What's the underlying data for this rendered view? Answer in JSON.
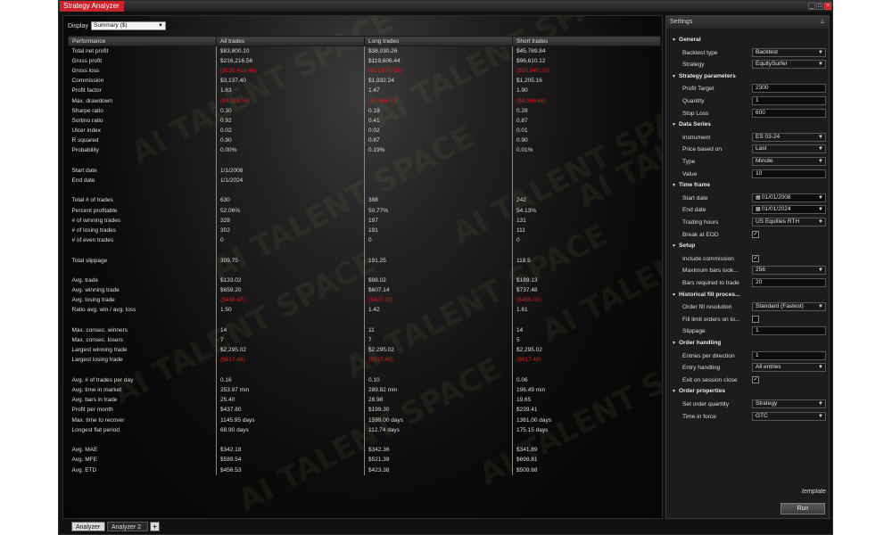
{
  "window": {
    "title": "Strategy Analyzer",
    "controls": [
      "_",
      "□",
      "×"
    ]
  },
  "display": {
    "label": "Display",
    "selected": "Summary ($)"
  },
  "table": {
    "columns": [
      "Performance",
      "All trades",
      "Long trades",
      "Short trades"
    ],
    "rows": [
      {
        "label": "Total net profit",
        "all": "$83,800.10",
        "long": "$38,030.26",
        "short": "$45,769.84"
      },
      {
        "label": "Gross profit",
        "all": "$216,216.56",
        "long": "$119,606.44",
        "short": "$96,610.12"
      },
      {
        "label": "Gross loss",
        "all": "($132,416.46)",
        "long": "($81,576.18)",
        "short": "($50,840.28)",
        "neg": true
      },
      {
        "label": "Commission",
        "all": "$3,137.40",
        "long": "$1,932.24",
        "short": "$1,205.16"
      },
      {
        "label": "Profit factor",
        "all": "1.63",
        "long": "1.47",
        "short": "1.90"
      },
      {
        "label": "Max. drawdown",
        "all": "($4,516.58)",
        "long": "($5,886.52)",
        "short": "($4,596.68)",
        "neg": true
      },
      {
        "label": "Sharpe ratio",
        "all": "0.30",
        "long": "0.19",
        "short": "0.28"
      },
      {
        "label": "Sortino ratio",
        "all": "0.92",
        "long": "0.41",
        "short": "0.87"
      },
      {
        "label": "Ulcer index",
        "all": "0.02",
        "long": "0.02",
        "short": "0.01"
      },
      {
        "label": "R squared",
        "all": "0.90",
        "long": "0.87",
        "short": "0.90"
      },
      {
        "label": "Probability",
        "all": "0.00%",
        "long": "0.19%",
        "short": "0.01%"
      },
      {
        "label": "",
        "all": "",
        "long": "",
        "short": ""
      },
      {
        "label": "Start date",
        "all": "1/1/2008",
        "long": "",
        "short": ""
      },
      {
        "label": "End date",
        "all": "1/1/2024",
        "long": "",
        "short": ""
      },
      {
        "label": "",
        "all": "",
        "long": "",
        "short": ""
      },
      {
        "label": "Total # of trades",
        "all": "630",
        "long": "388",
        "short": "242"
      },
      {
        "label": "Percent profitable",
        "all": "52.06%",
        "long": "50.77%",
        "short": "54.13%"
      },
      {
        "label": "# of winning trades",
        "all": "328",
        "long": "197",
        "short": "131"
      },
      {
        "label": "# of losing trades",
        "all": "302",
        "long": "191",
        "short": "111"
      },
      {
        "label": "# of even trades",
        "all": "0",
        "long": "0",
        "short": "0"
      },
      {
        "label": "",
        "all": "",
        "long": "",
        "short": ""
      },
      {
        "label": "Total slippage",
        "all": "309.75",
        "long": "191.25",
        "short": "118.5"
      },
      {
        "label": "",
        "all": "",
        "long": "",
        "short": ""
      },
      {
        "label": "Avg. trade",
        "all": "$133.02",
        "long": "$98.02",
        "short": "$189.13"
      },
      {
        "label": "Avg. winning trade",
        "all": "$659.20",
        "long": "$607.14",
        "short": "$737.48"
      },
      {
        "label": "Avg. losing trade",
        "all": "($438.47)",
        "long": "($427.10)",
        "short": "($458.02)",
        "neg": true
      },
      {
        "label": "Ratio avg. win / avg. loss",
        "all": "1.50",
        "long": "1.42",
        "short": "1.61"
      },
      {
        "label": "",
        "all": "",
        "long": "",
        "short": ""
      },
      {
        "label": "Max. consec. winners",
        "all": "14",
        "long": "11",
        "short": "14"
      },
      {
        "label": "Max. consec. losers",
        "all": "7",
        "long": "7",
        "short": "5"
      },
      {
        "label": "Largest winning trade",
        "all": "$2,295.02",
        "long": "$2,295.02",
        "short": "$2,295.02"
      },
      {
        "label": "Largest losing trade",
        "all": "($617.48)",
        "long": "($617.48)",
        "short": "($617.48)",
        "neg": true
      },
      {
        "label": "",
        "all": "",
        "long": "",
        "short": ""
      },
      {
        "label": "Avg. # of trades per day",
        "all": "0.16",
        "long": "0.10",
        "short": "0.06"
      },
      {
        "label": "Avg. time in market",
        "all": "253.97 min",
        "long": "289.82 min",
        "short": "196.49 min"
      },
      {
        "label": "Avg. bars in trade",
        "all": "25.40",
        "long": "28.98",
        "short": "19.65"
      },
      {
        "label": "Profit per month",
        "all": "$437.80",
        "long": "$199.30",
        "short": "$239.41"
      },
      {
        "label": "Max. time to recover",
        "all": "1145.95 days",
        "long": "1599.00 days",
        "short": "1361.00 days"
      },
      {
        "label": "Longest flat period",
        "all": "68.90 days",
        "long": "112.74 days",
        "short": "175.15 days"
      },
      {
        "label": "",
        "all": "",
        "long": "",
        "short": ""
      },
      {
        "label": "Avg. MAE",
        "all": "$342.18",
        "long": "$342.36",
        "short": "$341.89"
      },
      {
        "label": "Avg. MFE",
        "all": "$589.54",
        "long": "$521.39",
        "short": "$698.81"
      },
      {
        "label": "Avg. ETD",
        "all": "$456.53",
        "long": "$423.38",
        "short": "$509.68"
      }
    ]
  },
  "watermark": "AI TALENT SPACE",
  "settings": {
    "title": "Settings",
    "sections": [
      {
        "name": "General",
        "rows": [
          {
            "label": "Backtest type",
            "value": "Backtest",
            "kind": "select"
          },
          {
            "label": "Strategy",
            "value": "EquitySurfer",
            "kind": "select"
          }
        ]
      },
      {
        "name": "Strategy parameters",
        "rows": [
          {
            "label": "Profit Target",
            "value": "2300",
            "kind": "text"
          },
          {
            "label": "Quantity",
            "value": "1",
            "kind": "text"
          },
          {
            "label": "Stop Loss",
            "value": "600",
            "kind": "text"
          }
        ]
      },
      {
        "name": "Data Series",
        "rows": [
          {
            "label": "Instrument",
            "value": "ES 03-24",
            "kind": "select"
          },
          {
            "label": "Price based on",
            "value": "Last",
            "kind": "select"
          },
          {
            "label": "Type",
            "value": "Minute",
            "kind": "select"
          },
          {
            "label": "Value",
            "value": "10",
            "kind": "text"
          }
        ]
      },
      {
        "name": "Time frame",
        "rows": [
          {
            "label": "Start date",
            "value": "01/01/2008",
            "kind": "date"
          },
          {
            "label": "End date",
            "value": "01/01/2024",
            "kind": "date"
          },
          {
            "label": "Trading hours",
            "value": "US Equities RTH",
            "kind": "select"
          },
          {
            "label": "Break at EOD",
            "value": "✓",
            "kind": "check"
          }
        ]
      },
      {
        "name": "Setup",
        "rows": [
          {
            "label": "Include commission",
            "value": "✓",
            "kind": "check"
          },
          {
            "label": "Maximum bars look...",
            "value": "256",
            "kind": "select"
          },
          {
            "label": "Bars required to trade",
            "value": "20",
            "kind": "text"
          }
        ]
      },
      {
        "name": "Historical fill proces...",
        "rows": [
          {
            "label": "Order fill resolution",
            "value": "Standard (Fastest)",
            "kind": "select"
          },
          {
            "label": "Fill limit orders on to...",
            "value": "",
            "kind": "check"
          },
          {
            "label": "Slippage",
            "value": "1",
            "kind": "text"
          }
        ]
      },
      {
        "name": "Order handling",
        "rows": [
          {
            "label": "Entries per direction",
            "value": "1",
            "kind": "text"
          },
          {
            "label": "Entry handling",
            "value": "All entries",
            "kind": "select"
          },
          {
            "label": "Exit on session close",
            "value": "✓",
            "kind": "check"
          }
        ]
      },
      {
        "name": "Order properties",
        "rows": [
          {
            "label": "Set order quantity",
            "value": "Strategy",
            "kind": "select"
          },
          {
            "label": "Time in force",
            "value": "GTC",
            "kind": "select"
          }
        ]
      }
    ],
    "template_label": "template",
    "run_label": "Run"
  },
  "tabs": [
    {
      "label": "Analyzer",
      "active": true
    },
    {
      "label": "Analyzer 2",
      "active": false
    },
    {
      "label": "+",
      "active": false
    }
  ]
}
